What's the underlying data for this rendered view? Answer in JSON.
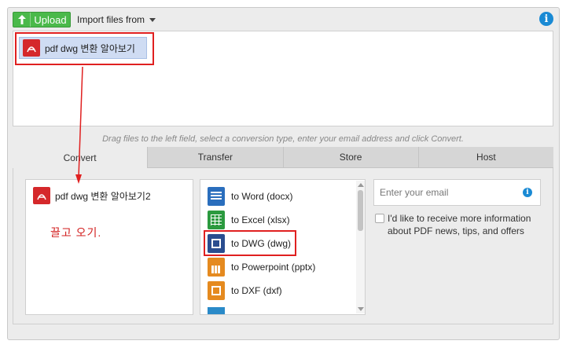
{
  "toolbar": {
    "upload_label": "Upload",
    "import_label": "Import files from",
    "info_glyph": "i"
  },
  "dropzone": {
    "file_name": "pdf dwg 변환 알아보기"
  },
  "hint_text": "Drag files to the left field, select a conversion type, enter your email address and click Convert.",
  "tabs": [
    {
      "label": "Convert",
      "active": true
    },
    {
      "label": "Transfer",
      "active": false
    },
    {
      "label": "Store",
      "active": false
    },
    {
      "label": "Host",
      "active": false
    }
  ],
  "convert": {
    "file_name": "pdf dwg 변환 알아보기2",
    "annotation": "끌고 오기.",
    "formats": [
      {
        "label": "to Word (docx)",
        "icon": "word-doc-icon",
        "color": "#2a6ebd"
      },
      {
        "label": "to Excel (xlsx)",
        "icon": "excel-sheet-icon",
        "color": "#2b9a3f"
      },
      {
        "label": "to DWG (dwg)",
        "icon": "dwg-drawing-icon",
        "color": "#2a4d8f",
        "highlighted": true
      },
      {
        "label": "to Powerpoint (pptx)",
        "icon": "powerpoint-icon",
        "color": "#e58a1f"
      },
      {
        "label": "to DXF (dxf)",
        "icon": "dxf-drawing-icon",
        "color": "#e58a1f"
      }
    ]
  },
  "email": {
    "placeholder": "Enter your email",
    "optin_text": "I'd like to receive more information about PDF news, tips, and offers"
  },
  "colors": {
    "upload_green": "#4ab94a",
    "info_blue": "#1a8ad4",
    "annotation_red": "#e02020",
    "pdf_red": "#d5282b"
  }
}
